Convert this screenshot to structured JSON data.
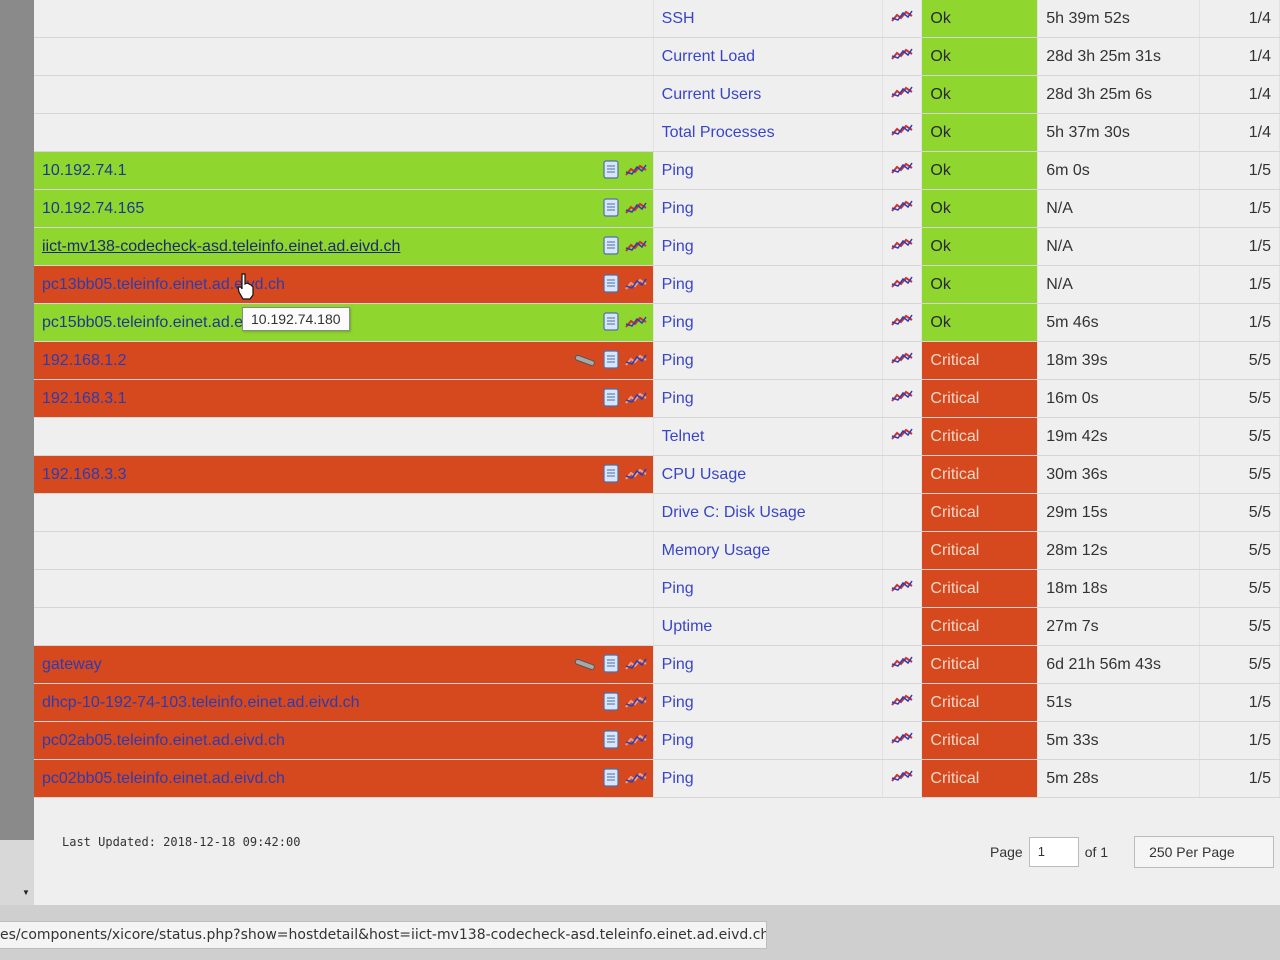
{
  "rows": [
    {
      "host": "",
      "host_state": "empty",
      "host_icons": [],
      "service": "SSH",
      "graph": true,
      "state": "Ok",
      "duration": "5h 39m 52s",
      "attempt": "1/4"
    },
    {
      "host": "",
      "host_state": "empty",
      "host_icons": [],
      "service": "Current Load",
      "graph": true,
      "state": "Ok",
      "duration": "28d 3h 25m 31s",
      "attempt": "1/4"
    },
    {
      "host": "",
      "host_state": "empty",
      "host_icons": [],
      "service": "Current Users",
      "graph": true,
      "state": "Ok",
      "duration": "28d 3h 25m 6s",
      "attempt": "1/4"
    },
    {
      "host": "",
      "host_state": "empty",
      "host_icons": [],
      "service": "Total Processes",
      "graph": true,
      "state": "Ok",
      "duration": "5h 37m 30s",
      "attempt": "1/4"
    },
    {
      "host": "10.192.74.1",
      "host_state": "ok",
      "host_icons": [
        "doc",
        "graph"
      ],
      "service": "Ping",
      "graph": true,
      "state": "Ok",
      "duration": "6m 0s",
      "attempt": "1/5"
    },
    {
      "host": "10.192.74.165",
      "host_state": "ok",
      "host_icons": [
        "doc",
        "graph"
      ],
      "service": "Ping",
      "graph": true,
      "state": "Ok",
      "duration": "N/A",
      "attempt": "1/5"
    },
    {
      "host": "iict-mv138-codecheck-asd.teleinfo.einet.ad.eivd.ch",
      "host_state": "ok",
      "hovered": true,
      "host_icons": [
        "doc",
        "graph"
      ],
      "service": "Ping",
      "graph": true,
      "state": "Ok",
      "duration": "N/A",
      "attempt": "1/5"
    },
    {
      "host": "pc13bb05.teleinfo.einet.ad.eivd.ch",
      "host_state": "critical",
      "host_icons": [
        "doc",
        "graph"
      ],
      "service": "Ping",
      "graph": true,
      "state": "Ok",
      "duration": "N/A",
      "attempt": "1/5"
    },
    {
      "host": "pc15bb05.teleinfo.einet.ad.eivd.ch",
      "host_state": "ok",
      "host_icons": [
        "doc",
        "graph"
      ],
      "service": "Ping",
      "graph": true,
      "state": "Ok",
      "duration": "5m 46s",
      "attempt": "1/5"
    },
    {
      "host": "192.168.1.2",
      "host_state": "critical",
      "host_icons": [
        "wrench",
        "doc",
        "graph"
      ],
      "service": "Ping",
      "graph": true,
      "state": "Critical",
      "duration": "18m 39s",
      "attempt": "5/5"
    },
    {
      "host": "192.168.3.1",
      "host_state": "critical",
      "host_icons": [
        "doc",
        "graph"
      ],
      "service": "Ping",
      "graph": true,
      "state": "Critical",
      "duration": "16m 0s",
      "attempt": "5/5"
    },
    {
      "host": "",
      "host_state": "empty",
      "host_icons": [],
      "service": "Telnet",
      "graph": true,
      "state": "Critical",
      "duration": "19m 42s",
      "attempt": "5/5"
    },
    {
      "host": "192.168.3.3",
      "host_state": "critical",
      "host_icons": [
        "doc",
        "graph"
      ],
      "service": "CPU Usage",
      "graph": false,
      "state": "Critical",
      "duration": "30m 36s",
      "attempt": "5/5"
    },
    {
      "host": "",
      "host_state": "empty",
      "host_icons": [],
      "service": "Drive C: Disk Usage",
      "graph": false,
      "state": "Critical",
      "duration": "29m 15s",
      "attempt": "5/5"
    },
    {
      "host": "",
      "host_state": "empty",
      "host_icons": [],
      "service": "Memory Usage",
      "graph": false,
      "state": "Critical",
      "duration": "28m 12s",
      "attempt": "5/5"
    },
    {
      "host": "",
      "host_state": "empty",
      "host_icons": [],
      "service": "Ping",
      "graph": true,
      "state": "Critical",
      "duration": "18m 18s",
      "attempt": "5/5"
    },
    {
      "host": "",
      "host_state": "empty",
      "host_icons": [],
      "service": "Uptime",
      "graph": false,
      "state": "Critical",
      "duration": "27m 7s",
      "attempt": "5/5"
    },
    {
      "host": "gateway",
      "host_state": "critical",
      "host_icons": [
        "wrench",
        "doc",
        "graph"
      ],
      "service": "Ping",
      "graph": true,
      "state": "Critical",
      "duration": "6d 21h 56m 43s",
      "attempt": "5/5"
    },
    {
      "host": "dhcp-10-192-74-103.teleinfo.einet.ad.eivd.ch",
      "host_state": "critical",
      "host_icons": [
        "doc",
        "graph"
      ],
      "service": "Ping",
      "graph": true,
      "state": "Critical",
      "duration": "51s",
      "attempt": "1/5"
    },
    {
      "host": "pc02ab05.teleinfo.einet.ad.eivd.ch",
      "host_state": "critical",
      "host_icons": [
        "doc",
        "graph"
      ],
      "service": "Ping",
      "graph": true,
      "state": "Critical",
      "duration": "5m 33s",
      "attempt": "1/5"
    },
    {
      "host": "pc02bb05.teleinfo.einet.ad.eivd.ch",
      "host_state": "critical",
      "host_icons": [
        "doc",
        "graph"
      ],
      "service": "Ping",
      "graph": true,
      "state": "Critical",
      "duration": "5m 28s",
      "attempt": "1/5"
    }
  ],
  "tooltip": "10.192.74.180",
  "footer": {
    "last_updated": "Last Updated: 2018-12-18 09:42:00",
    "page_label": "Page",
    "page_value": "1",
    "of_label": "of 1",
    "per_page": "250 Per Page"
  },
  "statusbar_url": "es/components/xicore/status.php?show=hostdetail&host=iict-mv138-codecheck-asd.teleinfo.einet.ad.eivd.ch",
  "colors": {
    "ok": "#8fd62f",
    "critical": "#d6491e",
    "link": "#3845c9"
  }
}
